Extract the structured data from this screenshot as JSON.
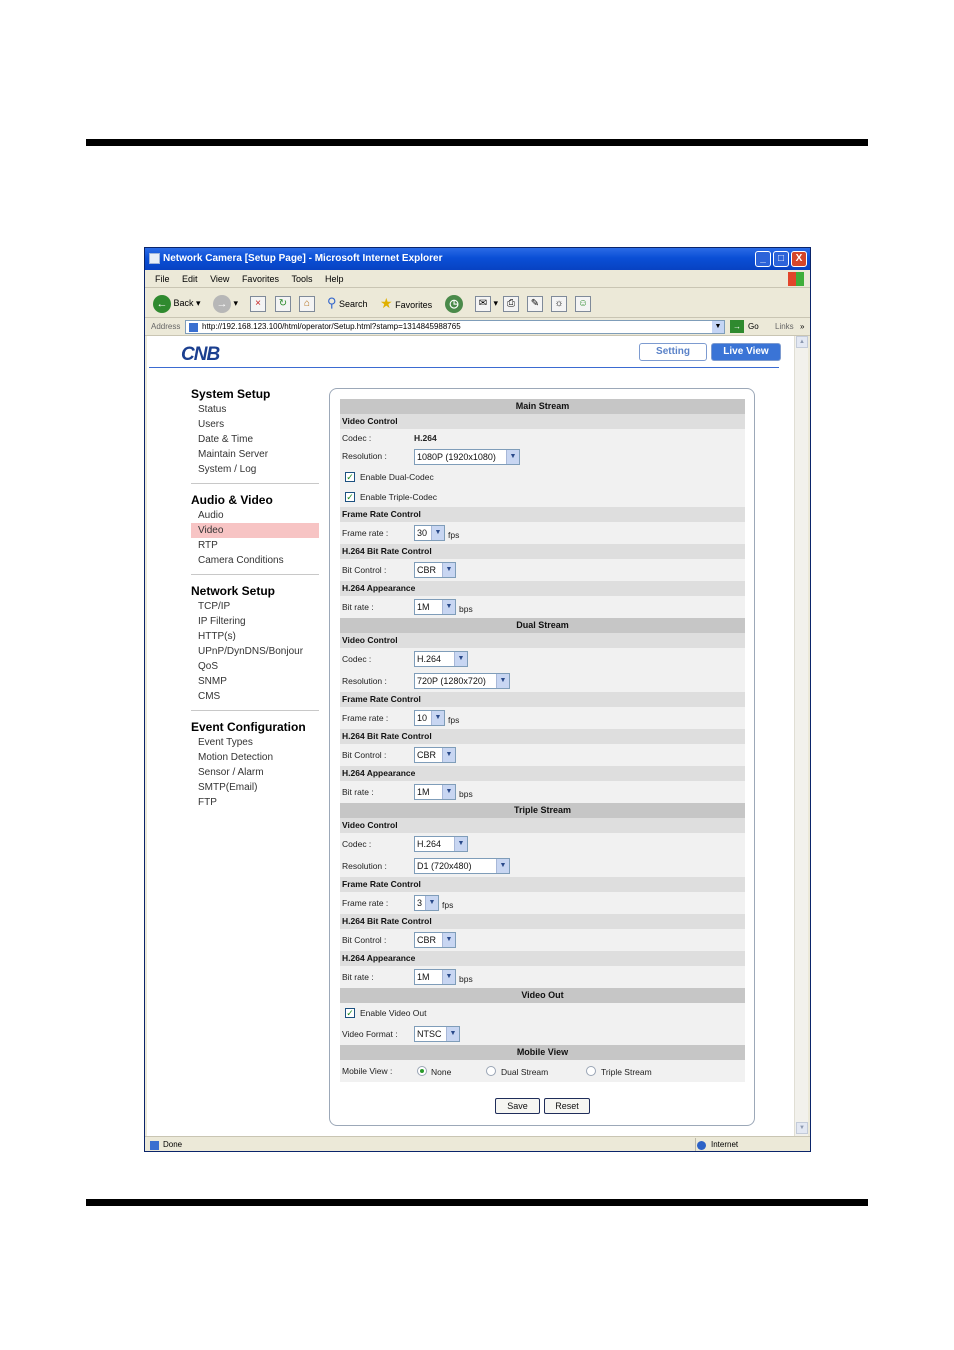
{
  "window": {
    "title": "Network Camera [Setup Page] - Microsoft Internet Explorer",
    "controls": [
      "_",
      "□",
      "X"
    ]
  },
  "menu": [
    "File",
    "Edit",
    "View",
    "Favorites",
    "Tools",
    "Help"
  ],
  "toolbar": {
    "back": "Back",
    "search": "Search",
    "favorites": "Favorites"
  },
  "address": {
    "label": "Address",
    "url": "http://192.168.123.100/html/operator/Setup.html?stamp=1314845988765",
    "go": "Go",
    "links": "Links"
  },
  "header": {
    "logo": "CNB",
    "setting": "Setting",
    "live_view": "Live View"
  },
  "sidebar": {
    "system_title": "System Setup",
    "system_items": [
      "Status",
      "Users",
      "Date & Time",
      "Maintain Server",
      "System / Log"
    ],
    "av_title": "Audio & Video",
    "av_items": [
      "Audio",
      "Video",
      "RTP",
      "Camera Conditions"
    ],
    "net_title": "Network Setup",
    "net_items": [
      "TCP/IP",
      "IP Filtering",
      "HTTP(s)",
      "UPnP/DynDNS/Bonjour",
      "QoS",
      "SNMP",
      "CMS"
    ],
    "event_title": "Event Configuration",
    "event_items": [
      "Event Types",
      "Motion Detection",
      "Sensor / Alarm",
      "SMTP(Email)",
      "FTP"
    ]
  },
  "main_stream": {
    "title": "Main Stream",
    "video_control": "Video Control",
    "codec_label": "Codec :",
    "codec_value": "H.264",
    "resolution_label": "Resolution :",
    "resolution": "1080P (1920x1080)",
    "dual_codec": "Enable Dual-Codec",
    "triple_codec": "Enable Triple-Codec",
    "frame_rate_control": "Frame Rate Control",
    "frame_rate_label": "Frame rate :",
    "frame_rate": "30",
    "fps": "fps",
    "bit_rate_control": "H.264 Bit Rate Control",
    "bit_control_label": "Bit Control :",
    "bit_control": "CBR",
    "appearance": "H.264 Appearance",
    "bit_rate_label": "Bit rate :",
    "bit_rate": "1M",
    "bps": "bps"
  },
  "dual_stream": {
    "title": "Dual Stream",
    "video_control": "Video Control",
    "codec_label": "Codec :",
    "codec": "H.264",
    "resolution_label": "Resolution :",
    "resolution": "720P (1280x720)",
    "frame_rate_control": "Frame Rate Control",
    "frame_rate_label": "Frame rate :",
    "frame_rate": "10",
    "fps": "fps",
    "bit_rate_control": "H.264 Bit Rate Control",
    "bit_control_label": "Bit Control :",
    "bit_control": "CBR",
    "appearance": "H.264 Appearance",
    "bit_rate_label": "Bit rate :",
    "bit_rate": "1M",
    "bps": "bps"
  },
  "triple_stream": {
    "title": "Triple Stream",
    "video_control": "Video Control",
    "codec_label": "Codec :",
    "codec": "H.264",
    "resolution_label": "Resolution :",
    "resolution": "D1 (720x480)",
    "frame_rate_control": "Frame Rate Control",
    "frame_rate_label": "Frame rate :",
    "frame_rate": "3",
    "fps": "fps",
    "bit_rate_control": "H.264 Bit Rate Control",
    "bit_control_label": "Bit Control :",
    "bit_control": "CBR",
    "appearance": "H.264 Appearance",
    "bit_rate_label": "Bit rate :",
    "bit_rate": "1M",
    "bps": "bps"
  },
  "video_out": {
    "title": "Video Out",
    "enable": "Enable Video Out",
    "format_label": "Video Format :",
    "format": "NTSC"
  },
  "mobile_view": {
    "title": "Mobile View",
    "label": "Mobile View :",
    "options": [
      "None",
      "Dual Stream",
      "Triple Stream"
    ],
    "selected": "None"
  },
  "buttons": {
    "save": "Save",
    "reset": "Reset"
  },
  "status": {
    "left": "Done",
    "zone": "Internet"
  }
}
